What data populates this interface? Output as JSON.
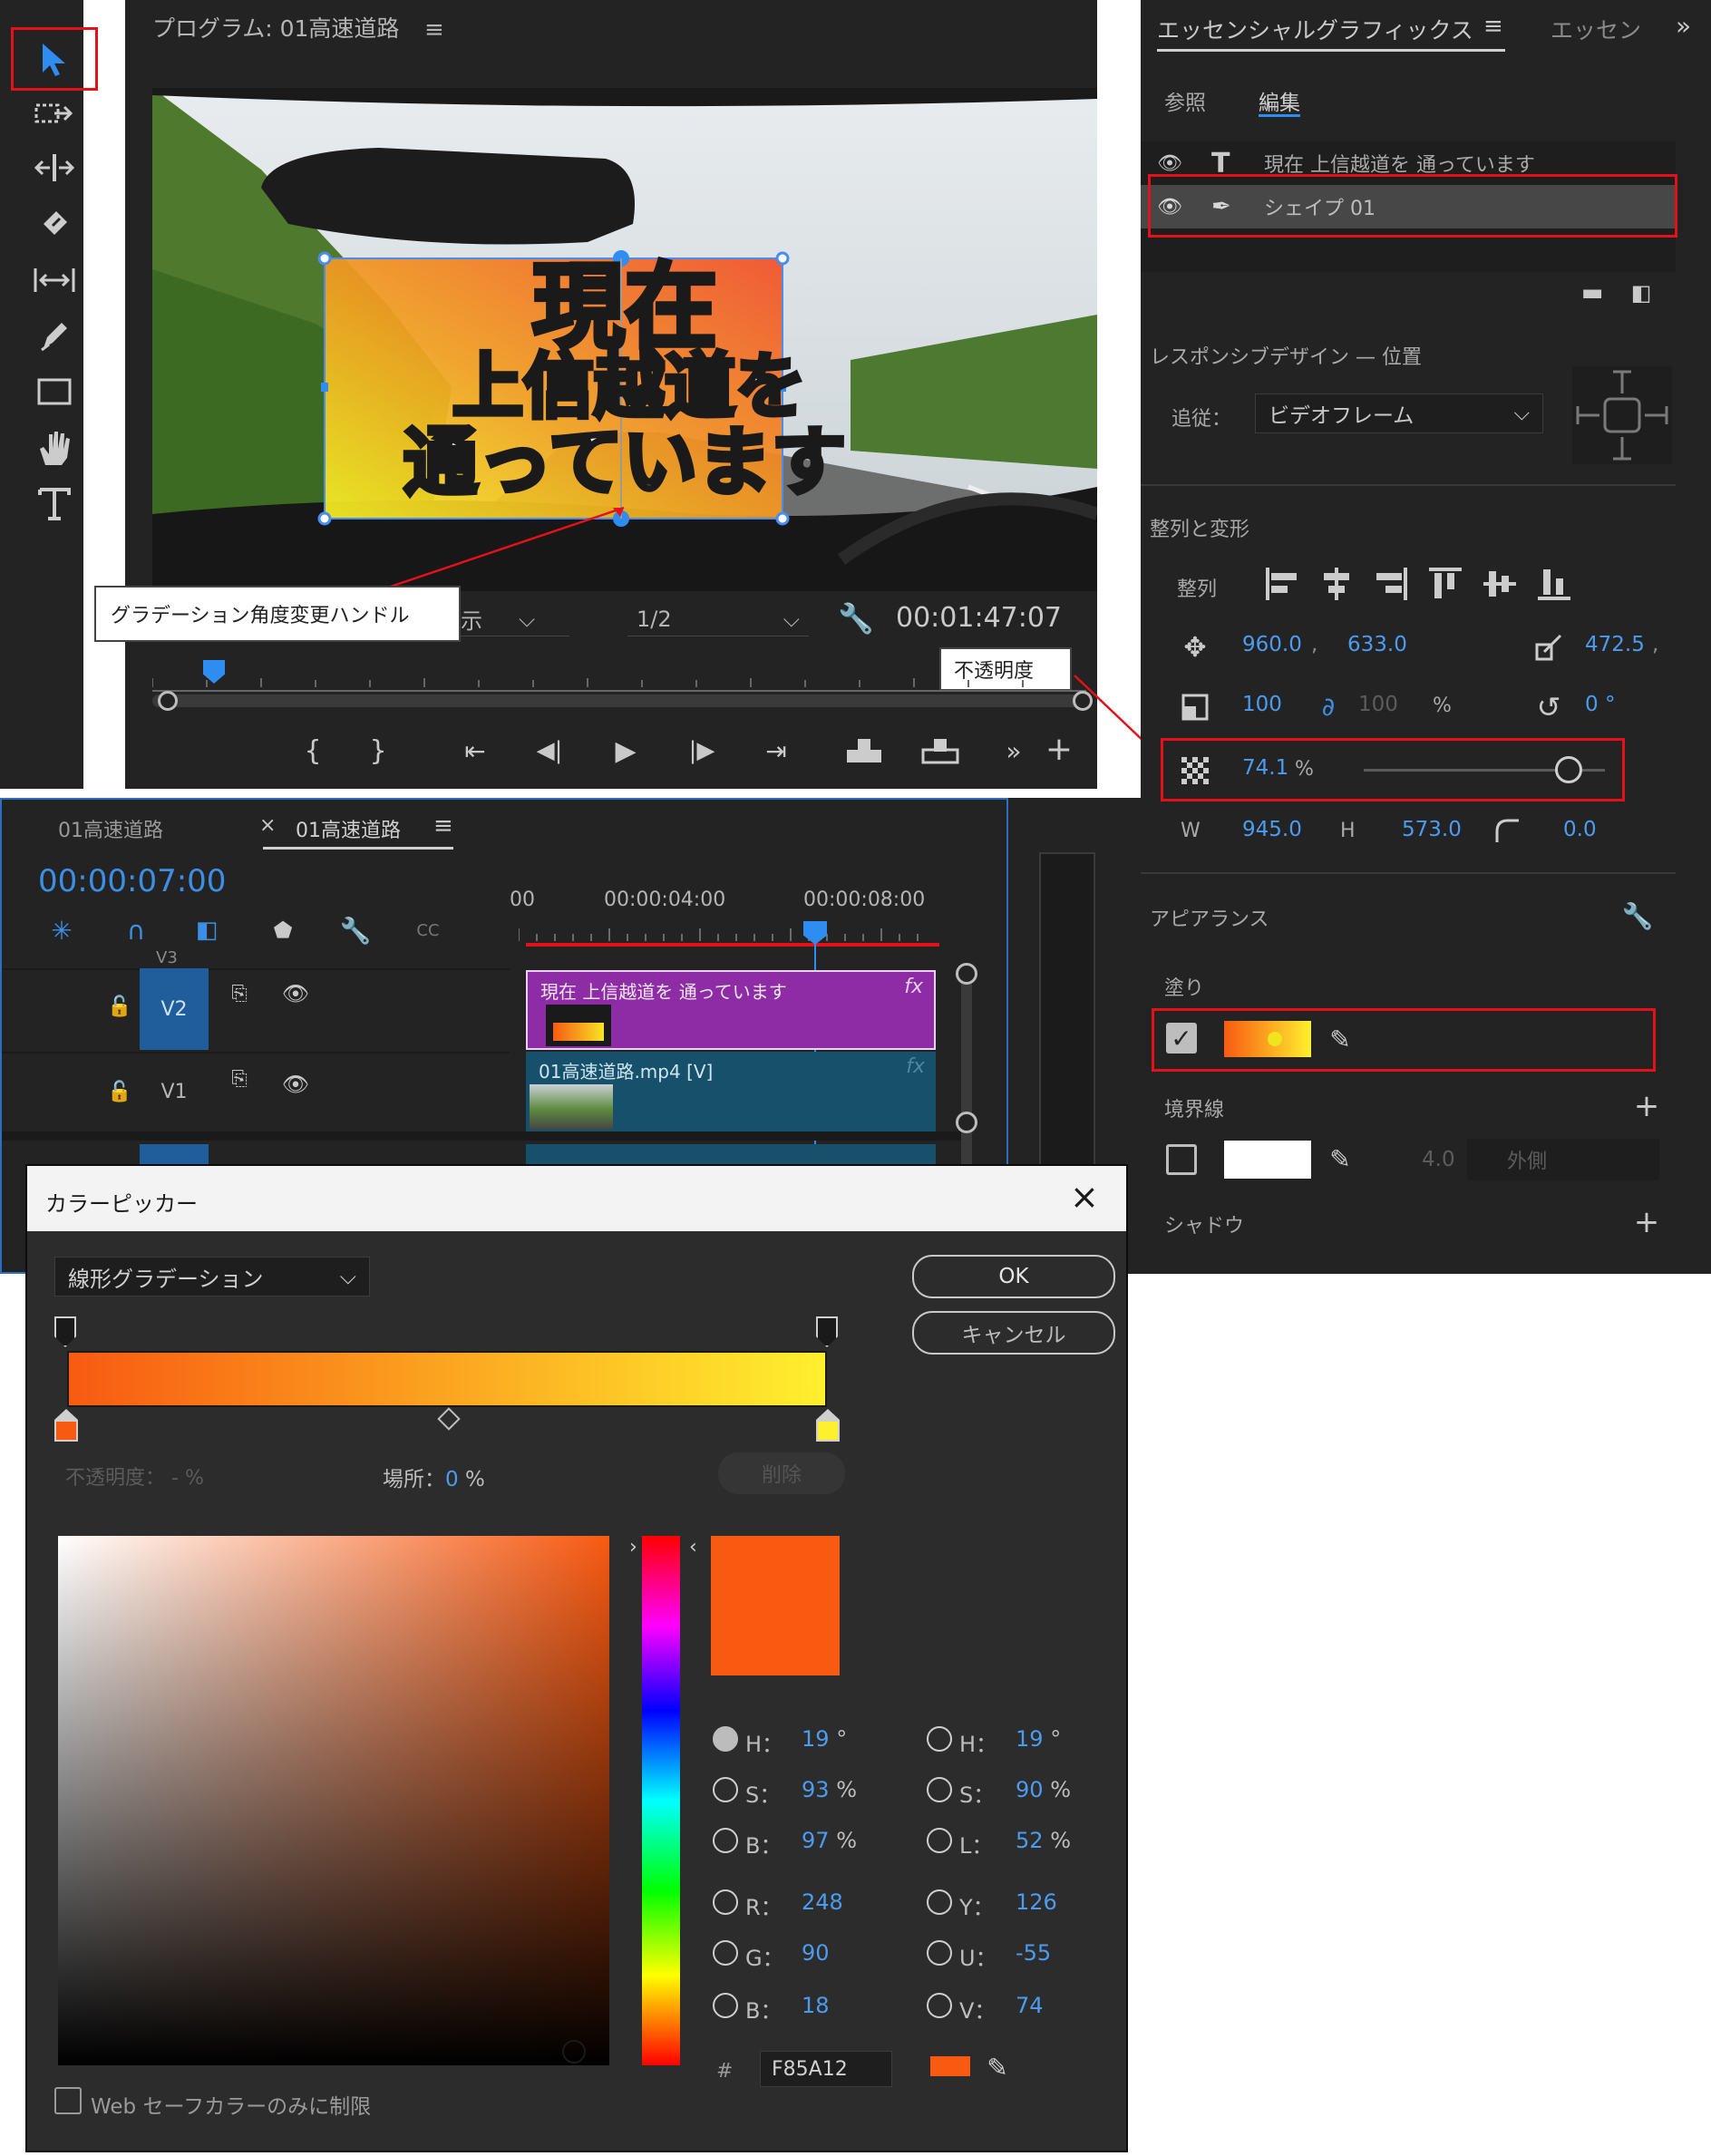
{
  "program": {
    "title": "プログラム: 01高速道路",
    "display_suffix": "示",
    "resolution": "1/2",
    "timecode": "00:01:47:07"
  },
  "video_text": {
    "line1": "現在",
    "line2": "上信越道を",
    "line3": "通っています"
  },
  "callouts": {
    "gradient_handle": "グラデーション角度変更ハンドル",
    "opacity": "不透明度"
  },
  "essential_graphics": {
    "tab_title": "エッセンシャルグラフィックス",
    "tab2": "エッセン",
    "subtab_browse": "参照",
    "subtab_edit": "編集",
    "layers": [
      {
        "name": "現在 上信越道を 通っています",
        "type": "text"
      },
      {
        "name": "シェイプ 01",
        "type": "shape"
      }
    ],
    "responsive_title": "レスポンシブデザイン — 位置",
    "follow_label": "追従：",
    "follow_value": "ビデオフレーム",
    "align_transform_title": "整列と変形",
    "align_label": "整列",
    "position_x": "960.0",
    "position_y": "633.0",
    "anchor_x": "472.5",
    "scale": "100",
    "scale2": "100",
    "percent": "%",
    "rotation": "0 °",
    "opacity_value": "74.1",
    "opacity_pct": "%",
    "opacity_fraction": 0.85,
    "w_label": "W",
    "w_value": "945.0",
    "h_label": "H",
    "h_value": "573.0",
    "corner_value": "0.0",
    "appearance_title": "アピアランス",
    "fill_label": "塗り",
    "stroke_label": "境界線",
    "stroke_width": "4.0",
    "stroke_position": "外側",
    "shadow_label": "シャドウ"
  },
  "timeline": {
    "tab1": "01高速道路",
    "tab2": "01高速道路",
    "timecode": "00:00:07:00",
    "ruler": [
      "00",
      "00:00:04:00",
      "00:00:08:00"
    ],
    "tracks": [
      "V3",
      "V2",
      "V1"
    ],
    "clip_v2": "現在 上信越道を 通っています",
    "clip_v1": "01高速道路.mp4 [V]",
    "fx": "fx"
  },
  "color_picker": {
    "title": "カラーピッカー",
    "mode": "線形グラデーション",
    "ok": "OK",
    "cancel": "キャンセル",
    "opacity_label": "不透明度：",
    "opacity_value": "- %",
    "location_label": "場所：",
    "location_value": "0",
    "location_unit": "%",
    "delete": "削除",
    "hsb": {
      "h_label": "H：",
      "h_value": "19",
      "h_unit": "°",
      "s_label": "S：",
      "s_value": "93",
      "s_unit": "%",
      "b_label": "B：",
      "b_value": "97",
      "b_unit": "%",
      "r_label": "R：",
      "r_value": "248",
      "g_label": "G：",
      "g_value": "90",
      "bl_label": "B：",
      "bl_value": "18"
    },
    "hsl": {
      "h_label": "H：",
      "h_value": "19",
      "h_unit": "°",
      "s_label": "S：",
      "s_value": "90",
      "s_unit": "%",
      "l_label": "L：",
      "l_value": "52",
      "l_unit": "%",
      "y_label": "Y：",
      "y_value": "126",
      "u_label": "U：",
      "u_value": "-55",
      "v_label": "V：",
      "v_value": "74"
    },
    "hash": "#",
    "hex": "F85A12",
    "web_safe": "Web セーフカラーのみに制限"
  },
  "colors": {
    "accent_blue": "#3d8fe6",
    "selected_color": "#F85A12",
    "gradient_end": "#FFF02E",
    "highlight_red": "#E2111A"
  }
}
